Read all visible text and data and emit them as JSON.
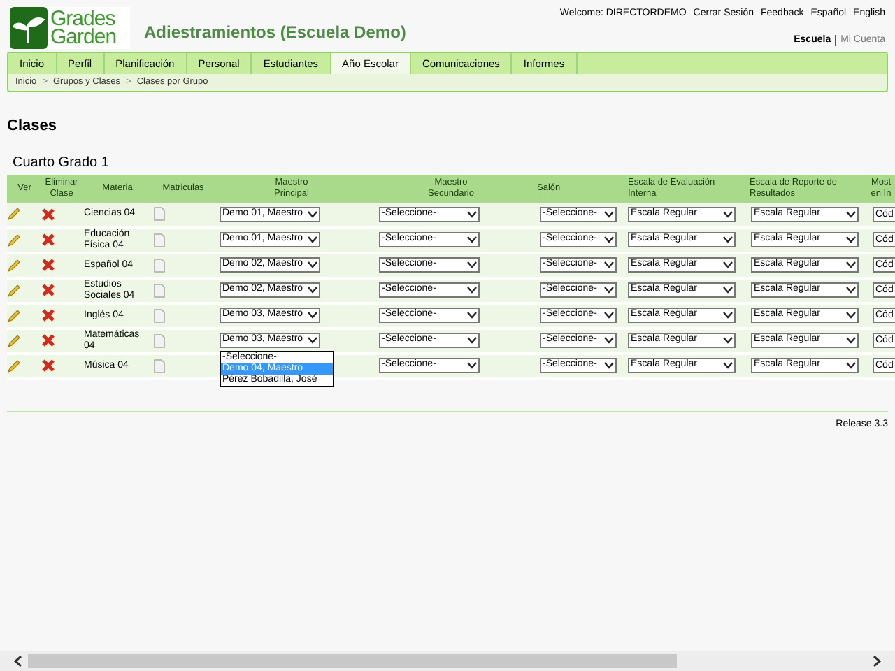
{
  "logo": {
    "line_1": "Grades",
    "line_2": "Garden"
  },
  "site_title": "Adiestramientos (Escuela Demo)",
  "top_links": [
    "Welcome: DIRECTORDEMO",
    "Cerrar Sesión",
    "Feedback",
    "Español",
    "English"
  ],
  "account_links": [
    {
      "label": "Escuela",
      "selected": true
    },
    {
      "label": "Mi Cuenta",
      "selected": false
    }
  ],
  "tabs": [
    {
      "label": "Inicio",
      "selected": false
    },
    {
      "label": "Perfil",
      "selected": false
    },
    {
      "label": "Planificación",
      "selected": false
    },
    {
      "label": "Personal",
      "selected": false
    },
    {
      "label": "Estudiantes",
      "selected": false
    },
    {
      "label": "Año Escolar",
      "selected": true
    },
    {
      "label": "Comunicaciones",
      "selected": false
    },
    {
      "label": "Informes",
      "selected": false
    }
  ],
  "breadcrumb": [
    "Inicio",
    "Grupos y Clases",
    "Clases por Grupo"
  ],
  "breadcrumb_separator": ">",
  "heading": "Clases",
  "group_title": "Cuarto Grado 1",
  "table": {
    "columns": [
      "Ver",
      "Eliminar\nClase",
      "Materia",
      "Matriculas",
      "Maestro\nPrincipal",
      "Maestro\nSecundario",
      "Salón",
      "Escala de Evaluación\nInterna",
      "Escala de Reporte de\nResultados",
      "Most\nen In"
    ],
    "rows": [
      {
        "materia": "Ciencias 04",
        "principal": {
          "value": "Demo 01, Maestro"
        },
        "secundario": "-Seleccione-",
        "salon": "-Seleccione-",
        "evaluacion": "Escala Regular",
        "reporte": "Escala Regular",
        "column_10": "Cód"
      },
      {
        "materia": "Educación Física 04",
        "principal": {
          "value": "Demo 01, Maestro"
        },
        "secundario": "-Seleccione-",
        "salon": "-Seleccione-",
        "evaluacion": "Escala Regular",
        "reporte": "Escala Regular",
        "column_10": "Cód"
      },
      {
        "materia": "Español 04",
        "principal": {
          "value": "Demo 02, Maestro"
        },
        "secundario": "-Seleccione-",
        "salon": "-Seleccione-",
        "evaluacion": "Escala Regular",
        "reporte": "Escala Regular",
        "column_10": "Cód"
      },
      {
        "materia": "Estudios Sociales 04",
        "principal": {
          "value": "Demo 02, Maestro"
        },
        "secundario": "-Seleccione-",
        "salon": "-Seleccione-",
        "evaluacion": "Escala Regular",
        "reporte": "Escala Regular",
        "column_10": "Cód"
      },
      {
        "materia": "Inglés 04",
        "principal": {
          "value": "Demo 03, Maestro"
        },
        "secundario": "-Seleccione-",
        "salon": "-Seleccione-",
        "evaluacion": "Escala Regular",
        "reporte": "Escala Regular",
        "column_10": "Cód"
      },
      {
        "materia": "Matemáticas 04",
        "principal": {
          "value": "Demo 03, Maestro",
          "options": [
            {
              "label": "-Seleccione-",
              "selected": false
            },
            {
              "label": "Demo 04, Maestro",
              "selected": true
            },
            {
              "label": "Pérez Bobadilla, José",
              "selected": false
            }
          ]
        },
        "secundario": "-Seleccione-",
        "salon": "-Seleccione-",
        "evaluacion": "Escala Regular",
        "reporte": "Escala Regular",
        "column_10": "Cód"
      },
      {
        "materia": "Música 04",
        "secundario": "-Seleccione-",
        "salon": "-Seleccione-",
        "evaluacion": "Escala Regular",
        "reporte": "Escala Regular",
        "column_10": "Cód"
      }
    ]
  },
  "release": "Release 3.3"
}
